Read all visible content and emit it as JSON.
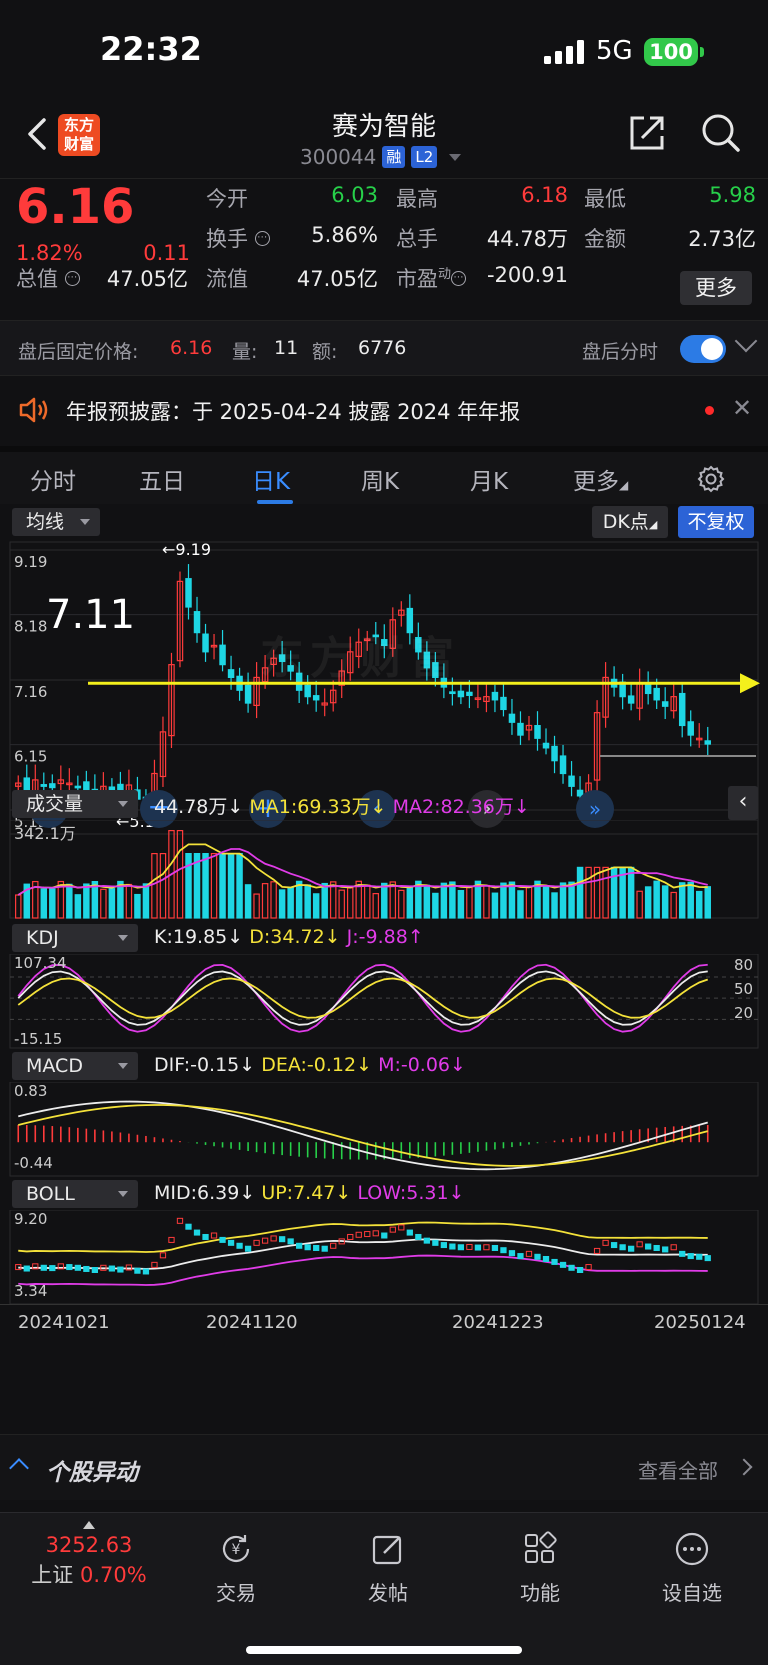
{
  "status": {
    "time": "22:32",
    "network": "5G",
    "battery": "100"
  },
  "nav": {
    "logo_line1": "东方",
    "logo_line2": "财富",
    "title": "赛为智能",
    "code": "300044",
    "tag1": "融",
    "tag2": "L2"
  },
  "quote": {
    "price": "6.16",
    "pct": "1.82%",
    "change": "0.11",
    "rows": [
      [
        {
          "label": "今开",
          "value": "6.03",
          "color": "#27d04a"
        },
        {
          "label": "最高",
          "value": "6.18",
          "color": "#ff3b3b"
        },
        {
          "label": "最低",
          "value": "5.98",
          "color": "#27d04a"
        }
      ],
      [
        {
          "label": "换手",
          "value": "5.86%",
          "color": "#ececec"
        },
        {
          "label": "总手",
          "value": "44.78万",
          "color": "#ececec"
        },
        {
          "label": "金额",
          "value": "2.73亿",
          "color": "#ececec"
        }
      ],
      [
        {
          "label": "总值",
          "value": "47.05亿",
          "color": "#ececec"
        },
        {
          "label": "流值",
          "value": "47.05亿",
          "color": "#ececec"
        },
        {
          "label": "市盈",
          "value": "-200.91",
          "color": "#ececec"
        }
      ]
    ],
    "pe_super": "动",
    "more": "更多"
  },
  "afterhours": {
    "label": "盘后固定价格:",
    "price": "6.16",
    "vol_label": "量:",
    "vol": "11",
    "amt_label": "额:",
    "amt": "6776",
    "timeshare": "盘后分时"
  },
  "notice": {
    "text": "年报预披露：于 2025-04-24 披露 2024 年年报"
  },
  "tabs": [
    "分时",
    "五日",
    "日K",
    "周K",
    "月K",
    "更多"
  ],
  "chart": {
    "ma_dropdown": "均线",
    "dk_button": "DK点",
    "rights_button": "不复权",
    "annotation_value": "7.11",
    "high_marker": "9.19",
    "low_marker": "5.13",
    "watermark": "东方财富",
    "volume": {
      "dropdown": "成交量",
      "value": "44.78万",
      "ma1": "MA1:69.33万",
      "ma2": "MA2:82.36万",
      "max_label": "342.1万"
    },
    "kdj": {
      "dropdown": "KDJ",
      "k": "K:19.85",
      "d": "D:34.72",
      "j": "J:-9.88",
      "top": "107.34",
      "bottom": "-15.15",
      "levels": [
        "80",
        "50",
        "20"
      ]
    },
    "macd": {
      "dropdown": "MACD",
      "dif": "DIF:-0.15",
      "dea": "DEA:-0.12",
      "m": "M:-0.06",
      "top": "0.83",
      "bottom": "-0.44"
    },
    "boll": {
      "dropdown": "BOLL",
      "mid": "MID:6.39",
      "up": "UP:7.47",
      "low": "LOW:5.31",
      "top": "9.20",
      "bottom": "3.34"
    },
    "dates": [
      "20241021",
      "20241120",
      "20241223",
      "20250124"
    ]
  },
  "chart_data": {
    "type": "candlestick",
    "y_ticks": [
      "9.19",
      "8.18",
      "7.16",
      "6.15",
      "5.13"
    ],
    "ylim": [
      5.13,
      9.19
    ],
    "annotation_line": 7.11,
    "candles_close": [
      5.55,
      5.45,
      5.6,
      5.5,
      5.48,
      5.6,
      5.55,
      5.5,
      5.42,
      5.35,
      5.5,
      5.45,
      5.38,
      5.52,
      5.3,
      5.25,
      5.7,
      6.35,
      7.4,
      8.7,
      8.3,
      7.9,
      7.6,
      7.7,
      7.4,
      7.2,
      7.0,
      6.8,
      7.2,
      7.35,
      7.5,
      7.45,
      7.3,
      7.0,
      6.9,
      6.85,
      6.8,
      7.0,
      7.3,
      7.6,
      7.75,
      7.8,
      7.85,
      7.7,
      8.1,
      8.25,
      7.9,
      7.6,
      7.35,
      7.2,
      7.05,
      6.95,
      6.9,
      6.92,
      6.88,
      6.9,
      6.85,
      6.7,
      6.5,
      6.3,
      6.45,
      6.25,
      6.1,
      5.9,
      5.7,
      5.5,
      5.35,
      5.55,
      6.65,
      7.2,
      7.05,
      6.9,
      6.8,
      7.1,
      6.95,
      6.85,
      6.75,
      6.9,
      6.45,
      6.3,
      6.25,
      6.16
    ],
    "volume_max": "342.1万",
    "dates": [
      "20241021",
      "20241120",
      "20241223",
      "20250124"
    ]
  },
  "bottom": {
    "title": "个股异动",
    "view_all": "查看全部"
  },
  "tabbar": {
    "index_value": "3252.63",
    "index_name": "上证",
    "index_pct": "0.70%",
    "items": [
      "交易",
      "发帖",
      "功能",
      "设自选"
    ]
  }
}
